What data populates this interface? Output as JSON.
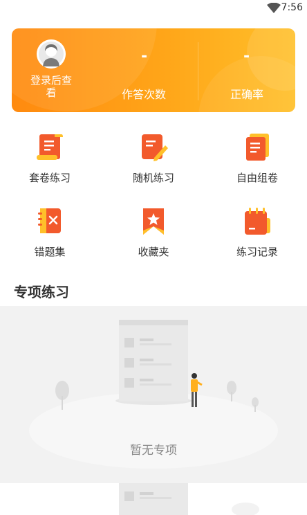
{
  "status_bar": {
    "time": "7:56",
    "wifi_icon": "wifi-icon"
  },
  "stats": {
    "login_prompt": "登录后查看",
    "answers": {
      "value": "-",
      "label": "作答次数"
    },
    "accuracy": {
      "value": "-",
      "label": "正确率"
    }
  },
  "menu": {
    "items": [
      {
        "label": "套卷练习",
        "icon": "scroll-paper-icon"
      },
      {
        "label": "随机练习",
        "icon": "edit-paper-icon"
      },
      {
        "label": "自由组卷",
        "icon": "stacked-paper-icon"
      },
      {
        "label": "错题集",
        "icon": "wrong-notebook-icon"
      },
      {
        "label": "收藏夹",
        "icon": "bookmark-star-icon"
      },
      {
        "label": "练习记录",
        "icon": "calendar-record-icon"
      }
    ]
  },
  "section": {
    "title": "专项练习"
  },
  "empty_state": {
    "text": "暂无专项"
  },
  "colors": {
    "accent": "#ff8a0f",
    "accent_light": "#ffc02a",
    "icon_red": "#f25a2c"
  }
}
